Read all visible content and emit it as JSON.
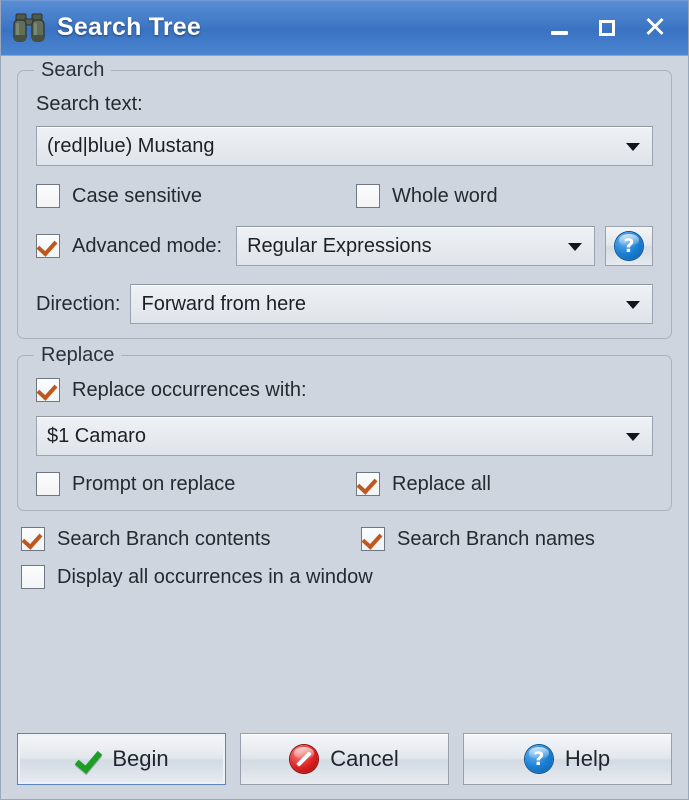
{
  "window": {
    "title": "Search Tree",
    "icon": "binoculars-icon",
    "controls": {
      "minimize": "_",
      "maximize": "□",
      "close": "✕"
    },
    "accent_titlebar": "#3f78c6",
    "accent_check": "#c0571d",
    "background": "#ced5de"
  },
  "search_group": {
    "title": "Search",
    "search_text_label": "Search text:",
    "search_text_value": "(red|blue) Mustang",
    "case_sensitive": {
      "label": "Case sensitive",
      "checked": false
    },
    "whole_word": {
      "label": "Whole word",
      "checked": false
    },
    "advanced_mode": {
      "label": "Advanced mode:",
      "checked": true
    },
    "advanced_mode_value": "Regular Expressions",
    "advanced_help_button": "?",
    "direction_label": "Direction:",
    "direction_value": "Forward from here"
  },
  "replace_group": {
    "title": "Replace",
    "replace_occurrences": {
      "label": "Replace occurrences with:",
      "checked": true
    },
    "replace_value": "$1 Camaro",
    "prompt_on_replace": {
      "label": "Prompt on replace",
      "checked": false
    },
    "replace_all": {
      "label": "Replace all",
      "checked": true
    }
  },
  "options": {
    "search_branch_contents": {
      "label": "Search Branch contents",
      "checked": true
    },
    "search_branch_names": {
      "label": "Search Branch names",
      "checked": true
    },
    "display_all_occurrences": {
      "label": "Display all occurrences in a window",
      "checked": false
    }
  },
  "footer": {
    "begin_label": "Begin",
    "cancel_label": "Cancel",
    "help_label": "Help",
    "help_glyph": "?"
  }
}
